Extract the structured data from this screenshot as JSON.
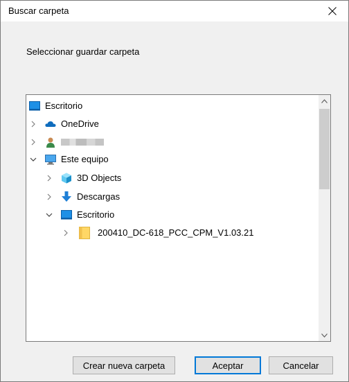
{
  "window": {
    "title": "Buscar carpeta",
    "close_icon": "close-icon"
  },
  "dialog": {
    "description": "Seleccionar guardar carpeta"
  },
  "tree": {
    "items": [
      {
        "label": "Escritorio",
        "icon": "desktop-icon",
        "expand": "none"
      },
      {
        "label": "OneDrive",
        "icon": "cloud-icon",
        "expand": "collapsed"
      },
      {
        "label": "",
        "icon": "user-icon",
        "expand": "collapsed"
      },
      {
        "label": "Este equipo",
        "icon": "computer-icon",
        "expand": "expanded"
      },
      {
        "label": "3D Objects",
        "icon": "cube-icon",
        "expand": "collapsed"
      },
      {
        "label": "Descargas",
        "icon": "download-icon",
        "expand": "collapsed"
      },
      {
        "label": "Escritorio",
        "icon": "desktop-icon",
        "expand": "expanded"
      },
      {
        "label": "200410_DC-618_PCC_CPM_V1.03.21",
        "icon": "folder-icon",
        "expand": "collapsed"
      }
    ]
  },
  "buttons": {
    "new_folder": "Crear nueva carpeta",
    "ok": "Aceptar",
    "cancel": "Cancelar"
  },
  "colors": {
    "accent": "#0078d7",
    "folder": "#ffd766",
    "onedrive": "#0f6cbd"
  }
}
